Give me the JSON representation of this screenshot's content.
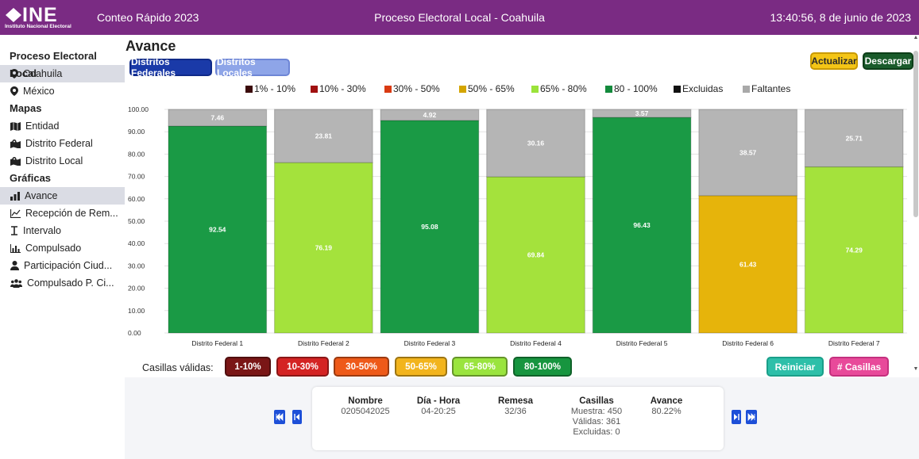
{
  "header": {
    "logo_text": "INE",
    "logo_sub": "Instituto Nacional Electoral",
    "app_title": "Conteo Rápido 2023",
    "process_title": "Proceso Electoral Local - Coahuila",
    "datetime": "13:40:56, 8 de junio de 2023"
  },
  "sidebar": {
    "section1": "Proceso Electoral Local",
    "states": [
      {
        "label": "Coahuila",
        "icon": "map-pin-icon"
      },
      {
        "label": "México",
        "icon": "map-pin-icon"
      }
    ],
    "section2": "Mapas",
    "maps": [
      {
        "label": "Entidad",
        "icon": "map-icon"
      },
      {
        "label": "Distrito Federal",
        "icon": "map-region-icon"
      },
      {
        "label": "Distrito Local",
        "icon": "map-region-icon"
      }
    ],
    "section3": "Gráficas",
    "charts": [
      {
        "label": "Avance",
        "icon": "bar-chart-icon"
      },
      {
        "label": "Recepción de Rem...",
        "icon": "line-chart-icon"
      },
      {
        "label": "Intervalo",
        "icon": "interval-icon"
      },
      {
        "label": "Compulsado",
        "icon": "column-chart-icon"
      },
      {
        "label": "Participación Ciud...",
        "icon": "person-icon"
      },
      {
        "label": "Compulsado P. Ci...",
        "icon": "people-icon"
      }
    ]
  },
  "main": {
    "title": "Avance",
    "tab_federal": "Distritos Federales",
    "tab_local": "Distritos Locales",
    "btn_update": "Actualizar",
    "btn_download": "Descargar"
  },
  "legend": [
    {
      "label": "1% - 10%",
      "color": "#3b0b0b"
    },
    {
      "label": "10% - 30%",
      "color": "#a01010"
    },
    {
      "label": "30% - 50%",
      "color": "#d93a12"
    },
    {
      "label": "50% - 65%",
      "color": "#d4a500"
    },
    {
      "label": "65% - 80%",
      "color": "#9be33a"
    },
    {
      "label": "80 - 100%",
      "color": "#138a3c"
    },
    {
      "label": "Excluidas",
      "color": "#111111"
    },
    {
      "label": "Faltantes",
      "color": "#a9a9a9"
    }
  ],
  "chart_data": {
    "type": "bar",
    "stacked": true,
    "categories": [
      "Distrito Federal 1",
      "Distrito Federal 2",
      "Distrito Federal 3",
      "Distrito Federal 4",
      "Distrito Federal 5",
      "Distrito Federal 6",
      "Distrito Federal 7"
    ],
    "series": [
      {
        "name": "Avance",
        "values": [
          92.54,
          76.19,
          95.08,
          69.84,
          96.43,
          61.43,
          74.29
        ],
        "colors": [
          "#1a9a45",
          "#a4e23c",
          "#1a9a45",
          "#a4e23c",
          "#1a9a45",
          "#e6b40b",
          "#a4e23c"
        ]
      },
      {
        "name": "Faltantes",
        "values": [
          7.46,
          23.81,
          4.92,
          30.16,
          3.57,
          38.57,
          25.71
        ],
        "colors": [
          "#b5b5b5",
          "#b5b5b5",
          "#b5b5b5",
          "#b5b5b5",
          "#b5b5b5",
          "#b5b5b5",
          "#b5b5b5"
        ]
      }
    ],
    "y_ticks": [
      "0.00",
      "10.00",
      "20.00",
      "30.00",
      "40.00",
      "50.00",
      "60.00",
      "70.00",
      "80.00",
      "90.00",
      "100.00"
    ],
    "ylim": [
      0,
      100
    ],
    "grid": true
  },
  "filters": {
    "label": "Casillas válidas:",
    "buttons": [
      {
        "label": "1-10%",
        "color": "#7a1616"
      },
      {
        "label": "10-30%",
        "color": "#d42323"
      },
      {
        "label": "30-50%",
        "color": "#ee5a19"
      },
      {
        "label": "50-65%",
        "color": "#f2b41d"
      },
      {
        "label": "65-80%",
        "color": "#9ae43e"
      },
      {
        "label": "80-100%",
        "color": "#17953f"
      }
    ],
    "reset": "Reiniciar",
    "casillas": "# Casillas"
  },
  "info": {
    "nombre_h": "Nombre",
    "nombre": "0205042025",
    "dia_h": "Día - Hora",
    "dia": "04-20:25",
    "remesa_h": "Remesa",
    "remesa": "32/36",
    "casillas_h": "Casillas",
    "muestra": "Muestra: 450",
    "validas": "Válidas: 361",
    "excluidas": "Excluidas: 0",
    "avance_h": "Avance",
    "avance": "80.22%"
  }
}
